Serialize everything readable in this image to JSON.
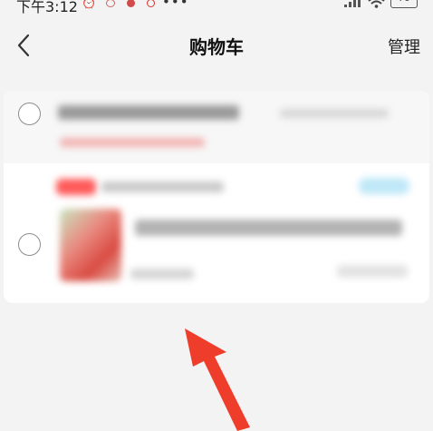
{
  "status_bar": {
    "time": "下午3:12",
    "alarm_icon": "alarm-clock-icon",
    "app_icons": [
      "notification-app-icon",
      "notification-app-icon",
      "notification-app-icon"
    ],
    "more": "•••",
    "signal_icon": "cellular-signal-icon",
    "wifi_icon": "wifi-icon",
    "battery_level": "76"
  },
  "header": {
    "back_icon": "chevron-left-icon",
    "title": "购物车",
    "manage_label": "管理"
  },
  "cart": {
    "store_selected": false,
    "item_selected": false,
    "blurred_content": true
  },
  "annotation": {
    "arrow_icon": "red-arrow-icon",
    "color": "#ee3d2a"
  }
}
